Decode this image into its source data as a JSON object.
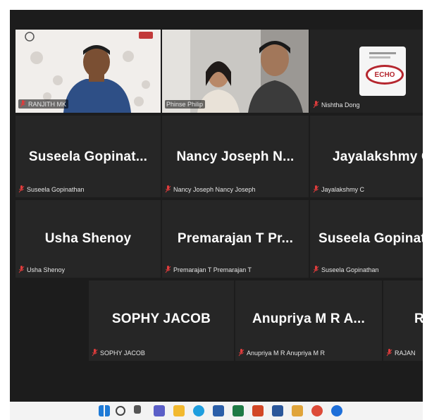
{
  "video_tiles": [
    {
      "name": "RANJITH MK"
    },
    {
      "name": "Phinse Philip"
    },
    {
      "name": "Nishtha Dong"
    }
  ],
  "echo_logo_text": "ECHO",
  "rows": [
    [
      {
        "display": "Suseela  Gopinat...",
        "label": "Suseela Gopinathan"
      },
      {
        "display": "Nancy Joseph N...",
        "label": "Nancy Joseph Nancy Joseph"
      },
      {
        "display": "Jayalakshmy C",
        "label": "Jayalakshmy C"
      }
    ],
    [
      {
        "display": "Usha Shenoy",
        "label": "Usha Shenoy"
      },
      {
        "display": "Premarajan T Pr...",
        "label": "Premarajan T Premarajan T"
      },
      {
        "display": "Suseela  Gopinathan",
        "label": "Suseela Gopinathan"
      }
    ],
    [
      {
        "display": "SOPHY JACOB",
        "label": "SOPHY JACOB"
      },
      {
        "display": "Anupriya M R A...",
        "label": "Anupriya M R Anupriya M R"
      },
      {
        "display": "RAJAN",
        "label": "RAJAN"
      }
    ]
  ],
  "taskbar_icons": [
    "windows-start-icon",
    "search-icon",
    "task-view-icon",
    "teams-icon",
    "file-explorer-icon",
    "edge-icon",
    "store-icon",
    "excel-icon",
    "powerpoint-icon",
    "word-icon",
    "app-icon",
    "chrome-icon",
    "app-icon"
  ],
  "colors": {
    "mic_muted": "#e03c3c",
    "active_speaker": "#3ecf8e",
    "stage_bg": "#1c1c1c"
  }
}
